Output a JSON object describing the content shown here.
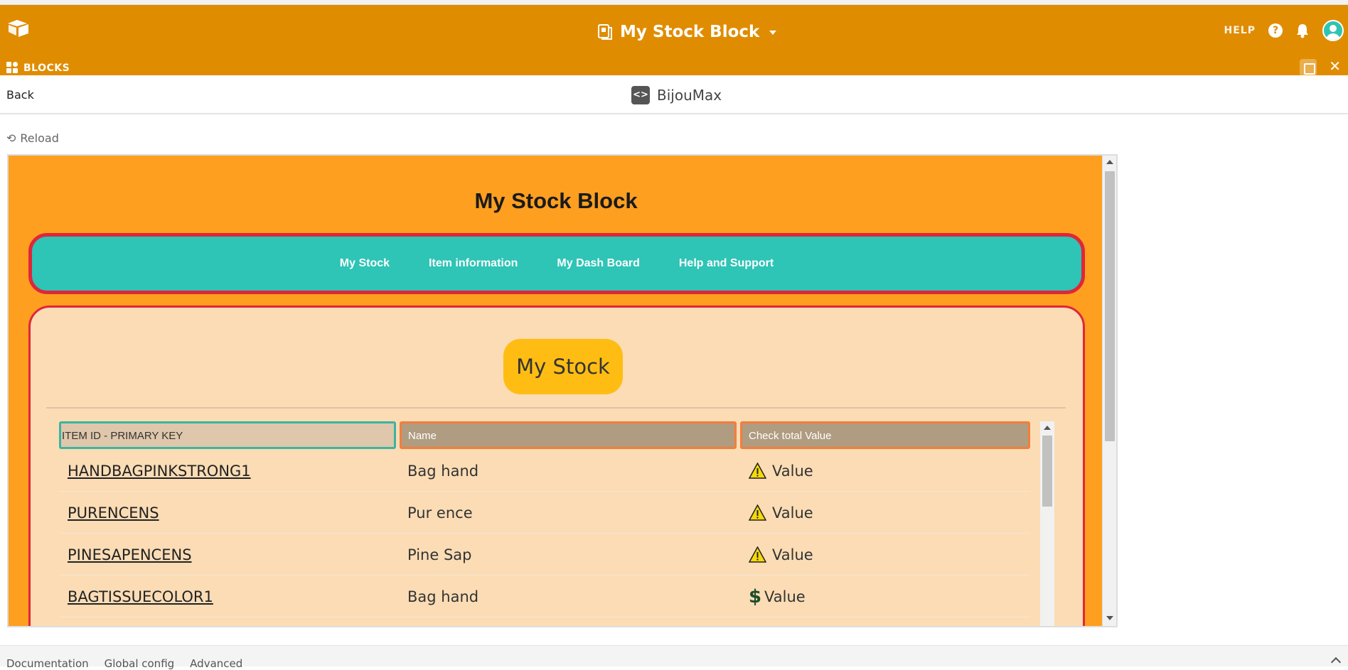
{
  "topbar": {
    "base_title": "My Stock Block",
    "help_label": "HELP",
    "logo_icon": "airtable-logo-icon",
    "accent": "#e08c00"
  },
  "blocks_bar": {
    "label": "BLOCKS"
  },
  "subheader": {
    "back_label": "Back",
    "block_name": "BijouMax",
    "code_icon_glyph": "<>"
  },
  "reload_label": "Reload",
  "app": {
    "title": "My Stock Block",
    "nav": [
      {
        "label": "My Stock"
      },
      {
        "label": "Item information"
      },
      {
        "label": "My Dash Board"
      },
      {
        "label": "Help and Support"
      }
    ],
    "section_title": "My Stock",
    "colors": {
      "background": "#ff9f1f",
      "nav_bg": "#2ec4b6",
      "border": "#e0263a",
      "panel": "#fbdcb5",
      "pill": "#ffbd14"
    }
  },
  "table": {
    "headers": [
      "ITEM ID - PRIMARY KEY",
      "Name",
      "Check total Value"
    ],
    "rows": [
      {
        "id": "HANDBAGPINKSTRONG1",
        "name": "Bag hand",
        "status_icon": "warning-icon",
        "value": "Value"
      },
      {
        "id": "PURENCENS",
        "name": "Pur ence",
        "status_icon": "warning-icon",
        "value": "Value"
      },
      {
        "id": "PINESAPENCENS",
        "name": "Pine Sap",
        "status_icon": "warning-icon",
        "value": "Value"
      },
      {
        "id": "BAGTISSUECOLOR1",
        "name": "Bag hand",
        "status_icon": "dollar-icon",
        "value": "Value"
      }
    ]
  },
  "footer": {
    "links": [
      "Documentation",
      "Global config",
      "Advanced"
    ]
  }
}
